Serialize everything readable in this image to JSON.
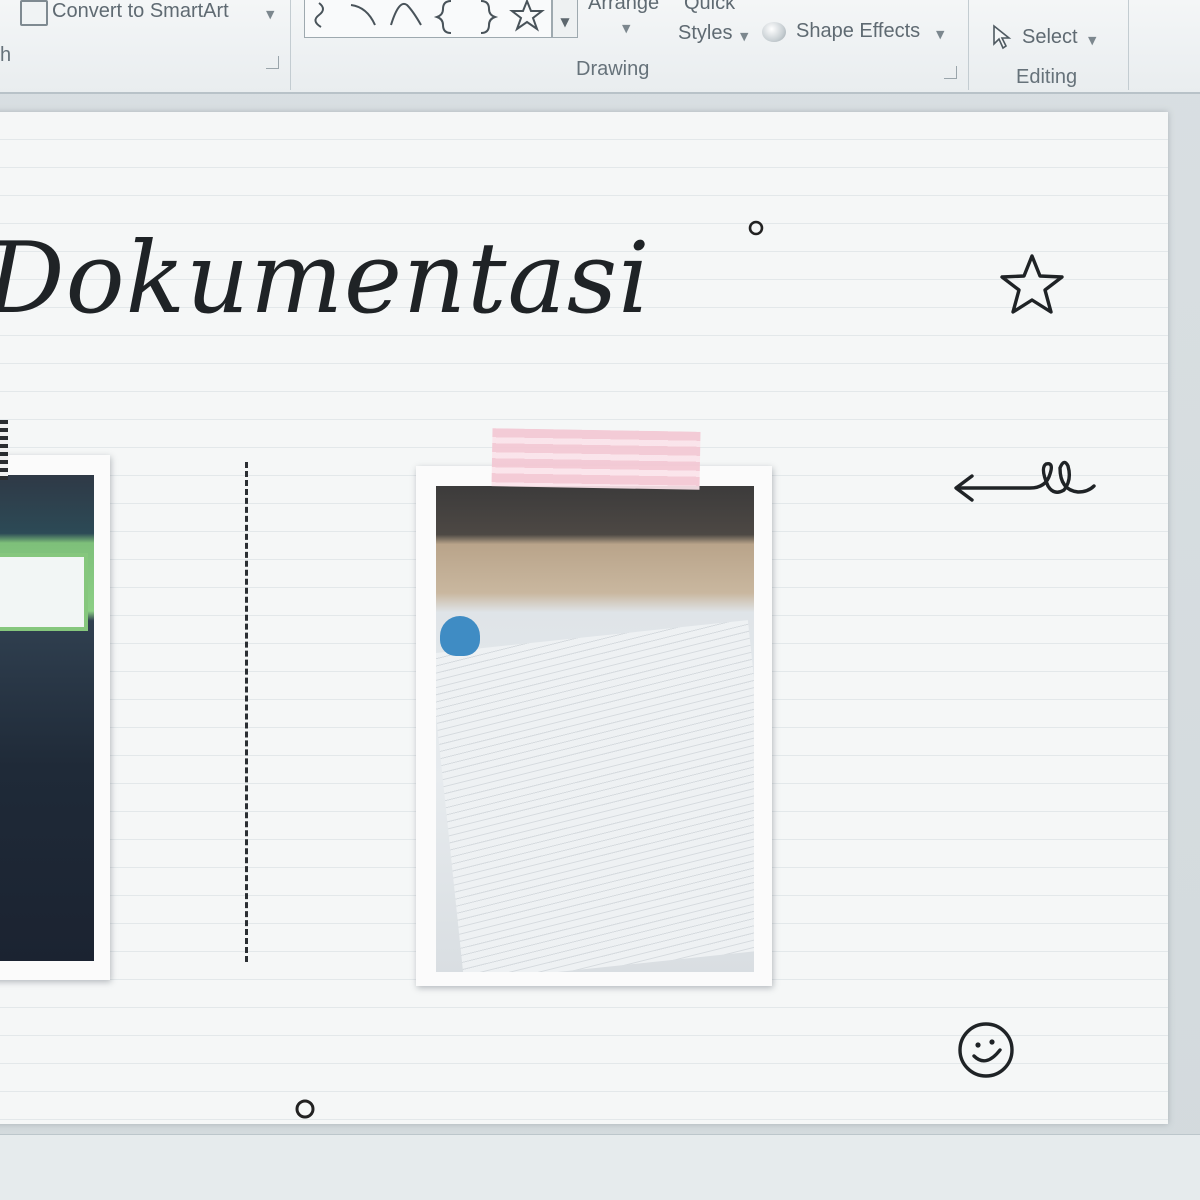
{
  "ribbon": {
    "convert_to_smartart": "Convert to SmartArt",
    "truncated_label": "h",
    "arrange": "Arrange",
    "quick_styles_line1": "Quick",
    "quick_styles_line2": "Styles",
    "shape_effects": "Shape Effects",
    "select": "Select",
    "drawing_group": "Drawing",
    "editing_group": "Editing"
  },
  "slide": {
    "title": "Dokumentasi"
  },
  "icons": [
    "smartart-icon",
    "shapes-gallery",
    "gallery-more-icon",
    "shape-effects-icon",
    "select-cursor-icon",
    "star-doodle",
    "arrow-doodle",
    "smiley-doodle",
    "circle-doodle"
  ],
  "colors": {
    "tape_pink": "#f3c7d3",
    "ink": "#1f2326",
    "slide_bg": "#f5f7f7"
  }
}
